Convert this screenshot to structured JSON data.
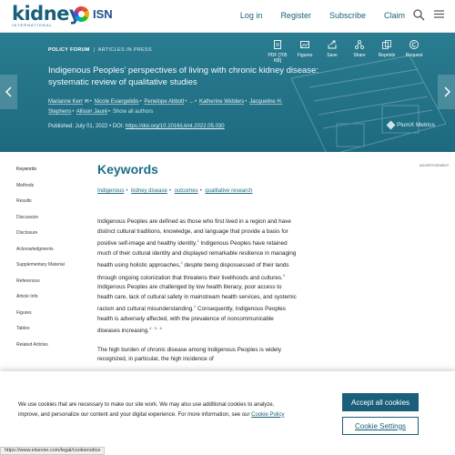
{
  "nav": {
    "brand": "kidney",
    "brand_sub": "INTERNATIONAL",
    "partner": "ISN",
    "links": [
      "Log in",
      "Register",
      "Subscribe",
      "Claim"
    ]
  },
  "hero": {
    "breadcrumb_section": "POLICY FORUM",
    "breadcrumb_status": "ARTICLES IN PRESS",
    "title": "Indigenous Peoples' perspectives of living with chronic kidney disease: systematic review of qualitative studies",
    "authors": [
      "Marianne Kerr",
      "Nicole Evangelidis",
      "Penelope Abbott",
      "...",
      "Katherine Widders",
      "Jacqueline H. Stephens",
      "Allison Jauré"
    ],
    "show_all": "Show all authors",
    "published": "Published: July 01, 2022",
    "doi_label": "DOI:",
    "doi": "https://doi.org/10.1016/j.kint.2022.05.030",
    "tools": [
      {
        "label": "PDF [705 KB]",
        "icon": "pdf-icon"
      },
      {
        "label": "Figures",
        "icon": "figures-icon"
      },
      {
        "label": "Save",
        "icon": "save-icon"
      },
      {
        "label": "Share",
        "icon": "share-icon"
      },
      {
        "label": "Reprints",
        "icon": "reprints-icon"
      },
      {
        "label": "Request",
        "icon": "request-icon"
      }
    ],
    "plumx": "PlumX Metrics"
  },
  "sidebar": {
    "items": [
      "Keywords",
      "Methods",
      "Results",
      "Discussion",
      "Disclosure",
      "Acknowledgments",
      "Supplementary Material",
      "References",
      "Article Info",
      "Figures",
      "Tables",
      "Related Articles"
    ]
  },
  "main": {
    "heading": "Keywords",
    "keywords": [
      "Indigenous",
      "kidney disease",
      "outcomes",
      "qualitative research"
    ],
    "ad_label": "ADVERTISEMENT",
    "para1_a": "Indigenous Peoples are defined as those who first lived in a region and have distinct cultural traditions, knowledge, and language that provide a basis for positive self-image and healthy identity.",
    "para1_sup1": "1",
    "para1_b": " Indigenous Peoples have retained much of their cultural identity and displayed remarkable resilience in managing health using holistic approaches,",
    "para1_sup2": "2",
    "para1_c": " despite being dispossessed of their lands through ongoing colonization that threatens their livelihoods and cultures.",
    "para1_sup3": "3",
    "para1_d": " Indigenous Peoples are challenged by low health literacy, poor access to health care, lack of cultural safety in mainstream health services, and systemic racism and cultural misunderstanding.",
    "para1_sup4": "2",
    "para1_e": " Consequently, Indigenous Peoples health is adversely affected, with the prevalence of noncommunicable diseases increasing.",
    "para1_sup5": "4 - 5 - 6",
    "para2": "The high burden of chronic disease among Indigenous Peoples is widely recognized, in particular, the high incidence of"
  },
  "cookie": {
    "text": "We use cookies that are necessary to make our site work. We may also use additional cookies to analyze, improve, and personalize our content and your digital experience. For more information, see our",
    "policy_link": "Cookie Policy",
    "accept": "Accept all cookies",
    "settings": "Cookie Settings"
  },
  "statusbar": "https://www.elsevier.com/legal/cookienotice"
}
